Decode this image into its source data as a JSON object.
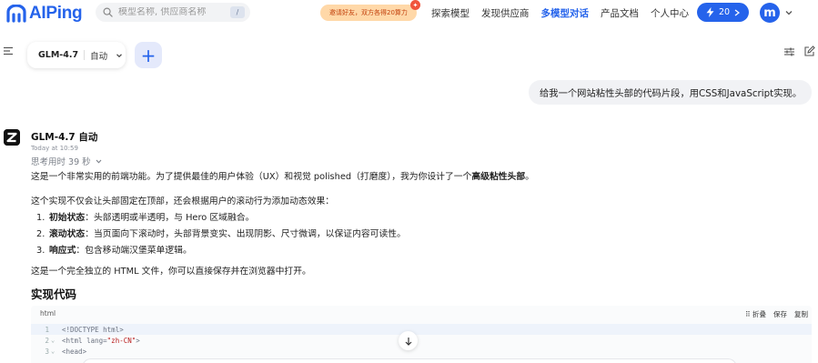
{
  "header": {
    "logo_text": "AIPing",
    "search": {
      "placeholder": "模型名称, 供应商名称",
      "shortcut": "/"
    },
    "promo": {
      "label": "邀请好友，双方各得20算力",
      "badge": "✦"
    },
    "nav": [
      {
        "label": "探索模型",
        "active": false
      },
      {
        "label": "发现供应商",
        "active": false
      },
      {
        "label": "多模型对话",
        "active": true
      },
      {
        "label": "产品文档",
        "active": false
      },
      {
        "label": "个人中心",
        "active": false
      }
    ],
    "credits": {
      "value": "20",
      "icon": "lightning-icon"
    },
    "avatar_letter": "m"
  },
  "toolbar": {
    "model_name": "GLM-4.7",
    "model_mode": "自动",
    "add_label": "+"
  },
  "chat": {
    "user_message": "给我一个网站粘性头部的代码片段，用CSS和JavaScript实现。",
    "assistant": {
      "name": "GLM-4.7 自动",
      "time": "Today at 10:59",
      "thinking": "思考用时 39 秒",
      "p1_prefix": "这是一个非常实用的前端功能。为了提供最佳的用户体验（UX）和视觉 polished（打磨度），我为你设计了一个",
      "p1_bold": "高级粘性头部",
      "p1_suffix": "。",
      "p2": "这个实现不仅会让头部固定在顶部，还会根据用户的滚动行为添加动态效果：",
      "list": [
        {
          "num": "1.",
          "bold": "初始状态",
          "text": "：头部透明或半透明，与 Hero 区域融合。"
        },
        {
          "num": "2.",
          "bold": "滚动状态",
          "text": "：当页面向下滚动时，头部背景变实、出现阴影、尺寸微调，以保证内容可读性。"
        },
        {
          "num": "3.",
          "bold": "响应式",
          "text": "：包含移动端汉堡菜单逻辑。"
        }
      ],
      "p3": "这是一个完全独立的 HTML 文件，你可以直接保存并在浏览器中打开。",
      "code_heading": "实现代码"
    }
  },
  "code_block": {
    "lang": "html",
    "actions": {
      "collapse": "折叠",
      "save": "保存",
      "copy": "复制",
      "collapse_icon": "⠿"
    },
    "lines": [
      {
        "no": "1",
        "fold": "",
        "pre": "<!DOCTYPE html>",
        "str": "",
        "post": ""
      },
      {
        "no": "2",
        "fold": "⌄",
        "pre": "<html lang=",
        "str": "\"zh-CN\"",
        "post": ">"
      },
      {
        "no": "3",
        "fold": "⌄",
        "pre": "<head>",
        "str": "",
        "post": ""
      }
    ]
  }
}
